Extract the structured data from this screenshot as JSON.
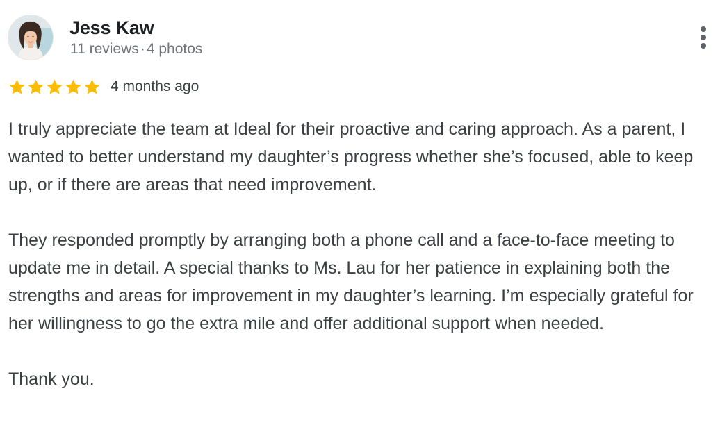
{
  "reviewer": {
    "name": "Jess Kaw",
    "reviews_count": "11 reviews",
    "separator": "·",
    "photos_count": "4 photos",
    "avatar_icon": "user-profile-photo"
  },
  "rating": {
    "stars": 5,
    "max_stars": 5,
    "star_color": "#fbbc04",
    "time_ago": "4 months ago"
  },
  "review": {
    "paragraphs": [
      "I truly appreciate the team at Ideal for their proactive and caring approach. As a parent, I wanted to better understand my daughter’s progress whether she’s focused, able to keep up, or if there are areas that need improvement.",
      "They responded promptly by arranging both a phone call and a face-to-face meeting to update me in detail. A special thanks to Ms. Lau for her patience in explaining both the strengths and areas for improvement in my daughter’s learning. I’m especially grateful for her willingness to go the extra mile and offer additional support when needed.",
      "Thank you."
    ]
  },
  "actions": {
    "more_icon": "more-vert-icon"
  },
  "colors": {
    "name_text": "#202124",
    "meta_text": "#70757a",
    "body_text": "#3c4043",
    "star": "#fbbc04"
  }
}
